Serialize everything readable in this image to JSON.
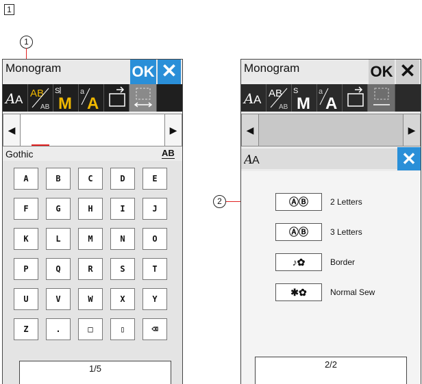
{
  "step_number": "1",
  "callouts": [
    "1",
    "2"
  ],
  "colors": {
    "accent_blue": "#2a8fd8",
    "toolbar_bg": "#1f1f1f",
    "menu_yellow": "#f0b800",
    "cursor_red": "#e02020"
  },
  "left_screen": {
    "title": "Monogram",
    "ok_label": "OK",
    "close_icon": "✕",
    "toolbar": [
      {
        "icon": "font-select-icon",
        "glyph": "AA"
      },
      {
        "icon": "letter-size-icon",
        "glyph": "AB"
      },
      {
        "icon": "monogram-icon",
        "glyph": "M"
      },
      {
        "icon": "case-toggle-icon",
        "glyph": "A"
      },
      {
        "icon": "open-file-icon",
        "glyph": ""
      },
      {
        "icon": "spacing-icon",
        "glyph": ""
      }
    ],
    "font_name": "Gothic",
    "size_label": "AB",
    "keys": [
      [
        "A",
        "B",
        "C",
        "D",
        "E"
      ],
      [
        "F",
        "G",
        "H",
        "I",
        "J"
      ],
      [
        "K",
        "L",
        "M",
        "N",
        "O"
      ],
      [
        "P",
        "Q",
        "R",
        "S",
        "T"
      ],
      [
        "U",
        "V",
        "W",
        "X",
        "Y"
      ],
      [
        "Z",
        ".",
        "□",
        "▯",
        "⌫"
      ]
    ],
    "page": "1/5"
  },
  "right_screen": {
    "title": "Monogram",
    "ok_label": "OK",
    "close_icon": "✕",
    "submenu_title": "AA",
    "options": [
      {
        "icon": "two-letters-icon",
        "glyph": "ⒶⒷ",
        "label": "2 Letters"
      },
      {
        "icon": "three-letters-icon",
        "glyph": "ⒶⒷ",
        "label": "3 Letters"
      },
      {
        "icon": "border-icon",
        "glyph": "♪✿",
        "label": "Border"
      },
      {
        "icon": "normal-sew-icon",
        "glyph": "✱✿",
        "label": "Normal Sew"
      }
    ],
    "page": "2/2"
  }
}
